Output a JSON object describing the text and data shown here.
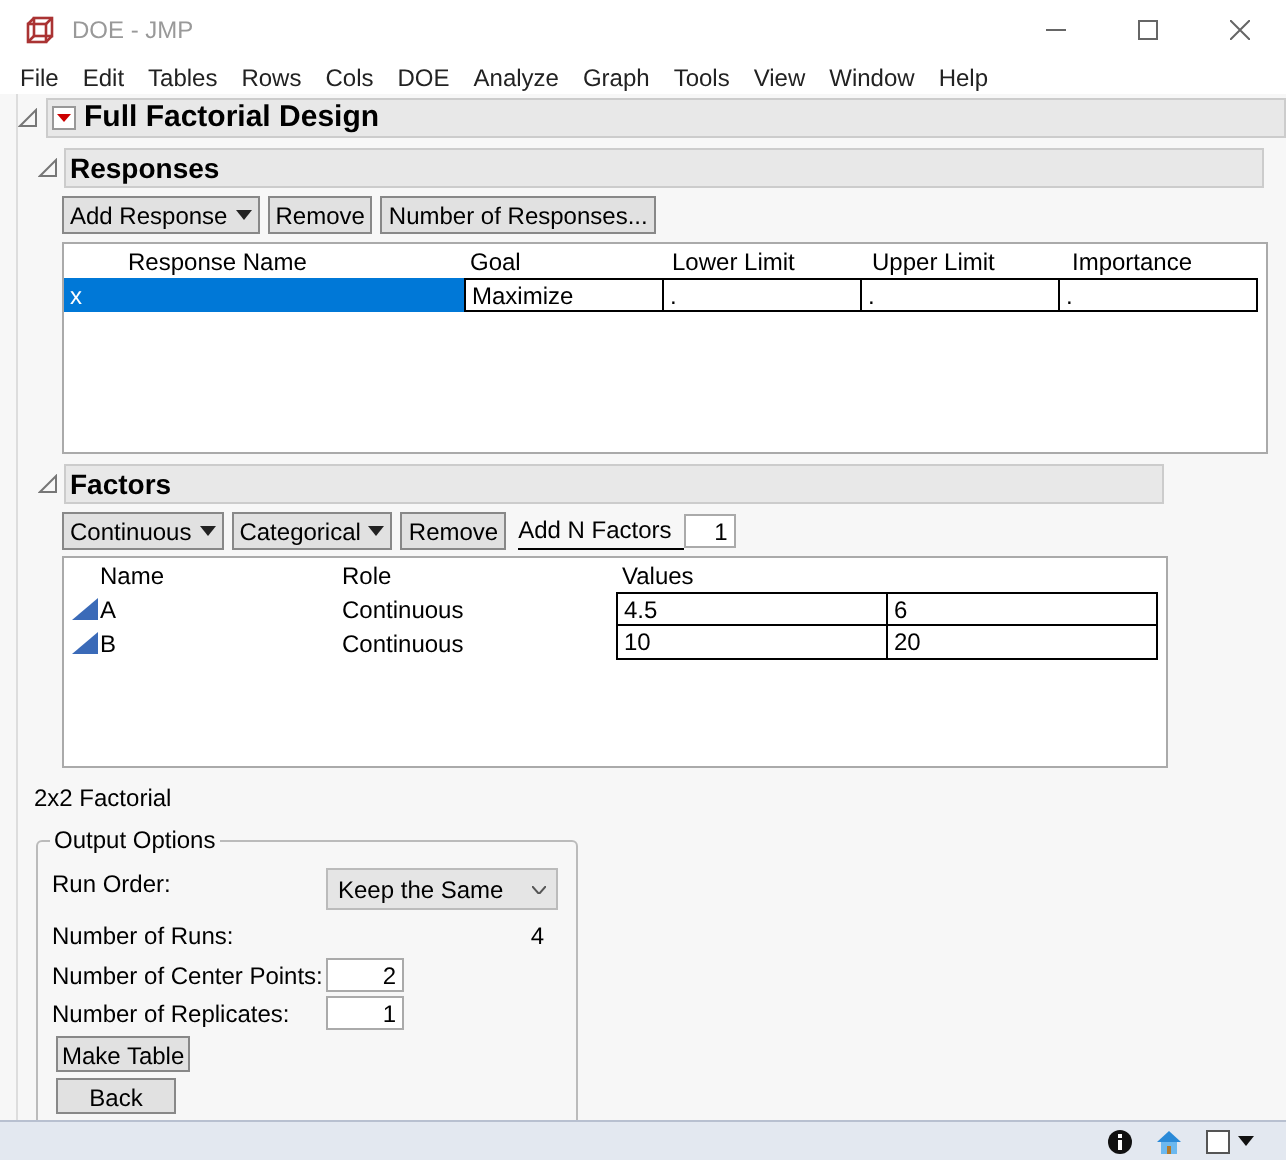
{
  "window": {
    "title": "DOE - JMP"
  },
  "menu": [
    "File",
    "Edit",
    "Tables",
    "Rows",
    "Cols",
    "DOE",
    "Analyze",
    "Graph",
    "Tools",
    "View",
    "Window",
    "Help"
  ],
  "report": {
    "title": "Full Factorial Design",
    "expanded": true
  },
  "responses": {
    "title": "Responses",
    "expanded": true,
    "buttons": [
      {
        "label": "Add Response",
        "kind": "menu"
      },
      {
        "label": "Remove",
        "kind": "button"
      },
      {
        "label": "Number of Responses...",
        "kind": "button"
      }
    ],
    "columns": [
      "Response Name",
      "Goal",
      "Lower Limit",
      "Upper Limit",
      "Importance"
    ],
    "rows": [
      {
        "selected": true,
        "cells": [
          "x",
          "Maximize",
          ".",
          ".",
          "."
        ]
      }
    ]
  },
  "factors": {
    "title": "Factors",
    "expanded": true,
    "buttons": [
      {
        "label": "Continuous",
        "kind": "menu"
      },
      {
        "label": "Categorical",
        "kind": "menu"
      },
      {
        "label": "Remove",
        "kind": "button"
      }
    ],
    "add_n": {
      "label": "Add N Factors",
      "value": "1"
    },
    "columns": [
      "Name",
      "Role",
      "Values"
    ],
    "rows": [
      {
        "name": "A",
        "role": "Continuous",
        "values": [
          "4.5",
          "6"
        ]
      },
      {
        "name": "B",
        "role": "Continuous",
        "values": [
          "10",
          "20"
        ]
      }
    ]
  },
  "design_label": "2x2 Factorial",
  "output_options": {
    "title": "Output Options",
    "run_order": {
      "label": "Run Order:",
      "value": "Keep the Same"
    },
    "runs": {
      "label": "Number of Runs:",
      "value": "4"
    },
    "center_points": {
      "label": "Number of Center Points:",
      "value": "2"
    },
    "replicates": {
      "label": "Number of Replicates:",
      "value": "1"
    },
    "buttons": [
      "Make Table",
      "Back"
    ]
  }
}
